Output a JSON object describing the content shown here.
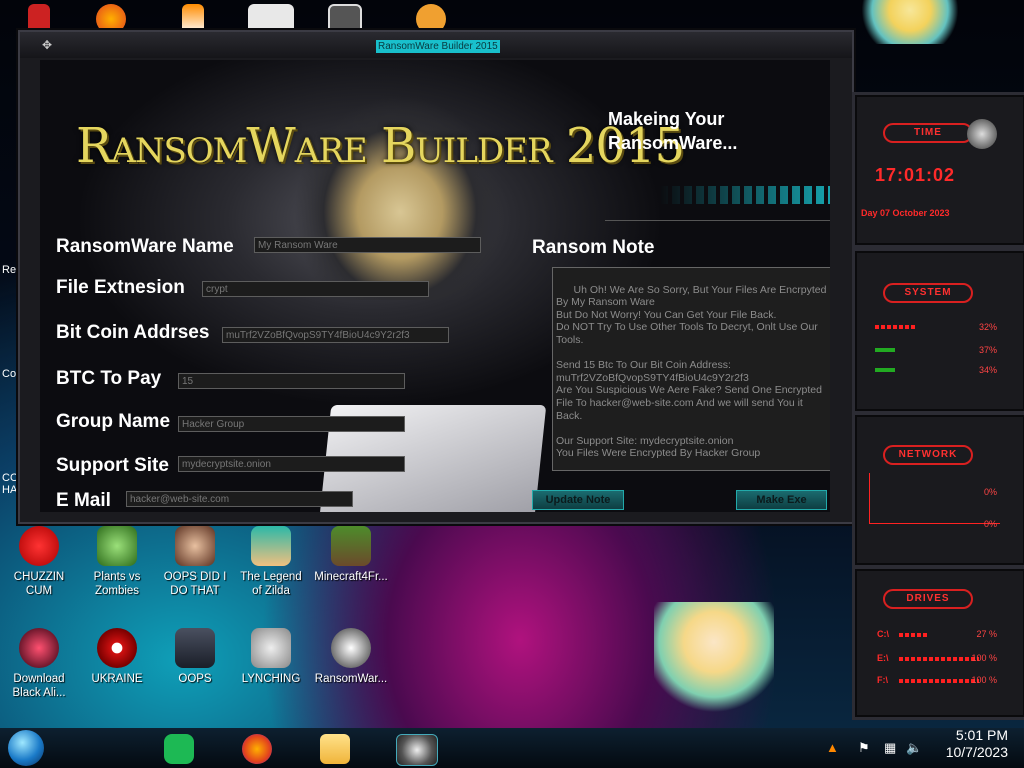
{
  "window": {
    "title": "RansomWare Builder 2015",
    "heading": "RansomWare Builder 2015",
    "status": "Makeing Your RansomWare..."
  },
  "form": {
    "name_label": "RansomWare Name",
    "name_value": "My Ransom Ware",
    "ext_label": "File Extnesion",
    "ext_value": "crypt",
    "btc_addr_label": "Bit Coin Addrses",
    "btc_addr_value": "muTrf2VZoBfQvopS9TY4fBioU4c9Y2r2f3",
    "btc_pay_label": "BTC To Pay",
    "btc_pay_value": "15",
    "group_label": "Group Name",
    "group_value": "Hacker Group",
    "site_label": "Support Site",
    "site_value": "mydecryptsite.onion",
    "email_label": "E Mail",
    "email_value": "hacker@web-site.com"
  },
  "ransom_note": {
    "label": "Ransom Note",
    "text": "Uh Oh! We Are So Sorry, But Your Files Are Encrpyted By My Ransom Ware\nBut Do Not Worry! You Can Get Your File Back.\nDo NOT Try To Use Other Tools To Decryt, Onlt Use Our Tools.\n\nSend 15 Btc To Our Bit Coin Address:\nmuTrf2VZoBfQvopS9TY4fBioU4c9Y2r2f3\nAre You Suspicious We Aere Fake? Send One Encrypted File To hacker@web-site.com And we will send You it Back.\n\nOur Support Site: mydecryptsite.onion\nYou Files Were Encrypted By Hacker Group",
    "update_label": "Update Note",
    "make_label": "Make Exe"
  },
  "gadgets": {
    "time_head": "TIME",
    "time_value": "17:01:02",
    "date_value": "Day 07 October 2023",
    "system_head": "SYSTEM",
    "system_values": [
      "32%",
      "37%",
      "34%"
    ],
    "network_head": "NETWORK",
    "network_values": [
      "0%",
      "0%"
    ],
    "drives_head": "DRIVES",
    "drives": [
      {
        "label": "C:\\",
        "value": "27 %"
      },
      {
        "label": "E:\\",
        "value": "100 %"
      },
      {
        "label": "F:\\",
        "value": "100 %"
      }
    ]
  },
  "desktop_icons": [
    {
      "label": "CHUZZIN CUM"
    },
    {
      "label": "Plants vs Zombies"
    },
    {
      "label": "OOPS DID I DO THAT"
    },
    {
      "label": "The Legend of Zilda"
    },
    {
      "label": "Minecraft4Fr..."
    },
    {
      "label": "Download Black Ali..."
    },
    {
      "label": "UKRAINE"
    },
    {
      "label": "OOPS"
    },
    {
      "label": "LYNCHING"
    },
    {
      "label": "RansomWar..."
    }
  ],
  "edge_labels": [
    "Re",
    "Co",
    "CO HA"
  ],
  "taskbar": {
    "time": "5:01 PM",
    "date": "10/7/2023"
  },
  "colors": {
    "accent_cyan": "#19c0cc",
    "title_gold": "#e5d65e",
    "gadget_red": "#ff2a2a"
  }
}
